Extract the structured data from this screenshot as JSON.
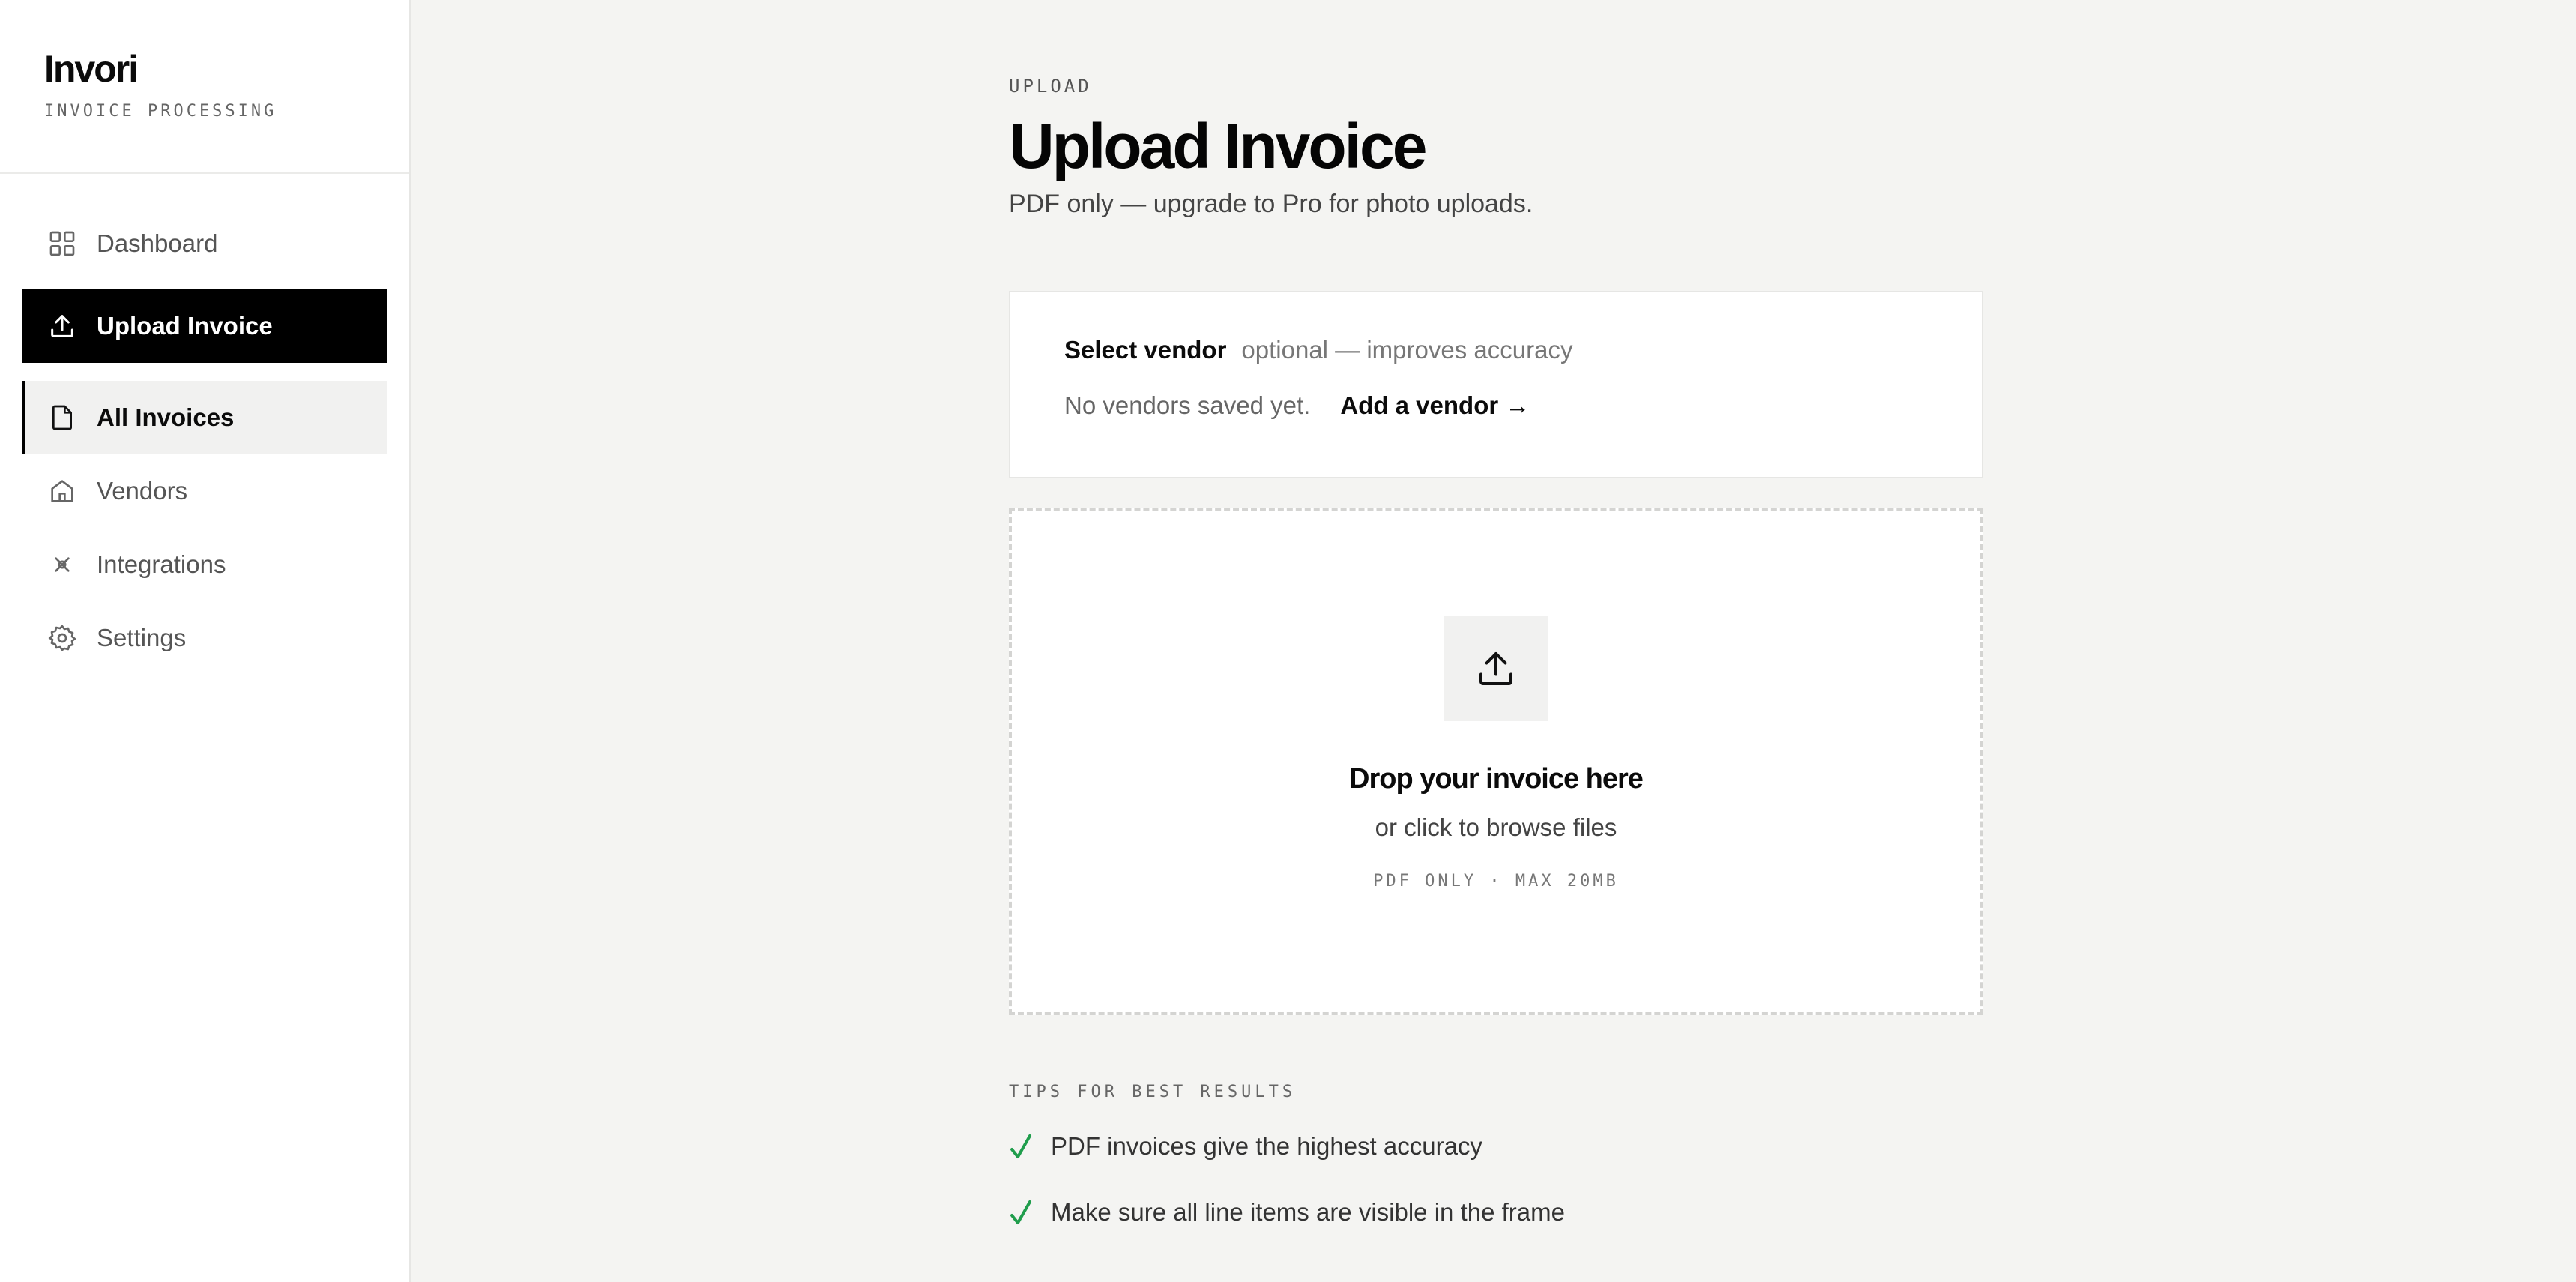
{
  "brand": {
    "name": "Invori",
    "tagline": "INVOICE PROCESSING"
  },
  "sidebar": {
    "items": [
      {
        "label": "Dashboard",
        "icon": "grid-icon"
      },
      {
        "label": "Upload Invoice",
        "icon": "upload-icon"
      },
      {
        "label": "All Invoices",
        "icon": "document-icon"
      },
      {
        "label": "Vendors",
        "icon": "home-icon"
      },
      {
        "label": "Integrations",
        "icon": "link-icon"
      },
      {
        "label": "Settings",
        "icon": "gear-icon"
      }
    ]
  },
  "page": {
    "eyebrow": "UPLOAD",
    "title": "Upload Invoice",
    "subtitle": "PDF only — upgrade to Pro for photo uploads."
  },
  "vendor": {
    "label": "Select vendor",
    "hint": "optional — improves accuracy",
    "empty": "No vendors saved yet.",
    "add_link": "Add a vendor →"
  },
  "dropzone": {
    "title": "Drop your invoice here",
    "subtitle": "or click to browse files",
    "meta": "PDF ONLY · MAX 20MB",
    "icon": "upload-icon"
  },
  "tips": {
    "heading": "TIPS FOR BEST RESULTS",
    "items": [
      "PDF invoices give the highest accuracy",
      "Make sure all line items are visible in the frame"
    ],
    "check_color": "#1f9d4c"
  },
  "colors": {
    "accent": "#000000",
    "background": "#f4f4f2",
    "surface": "#ffffff"
  }
}
